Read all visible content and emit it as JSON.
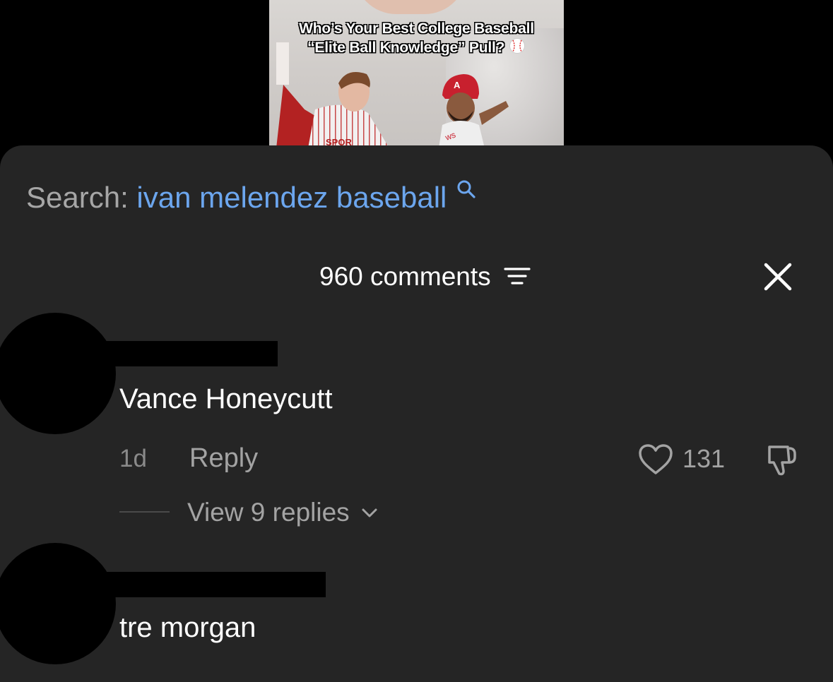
{
  "video": {
    "title_line1": "Who’s Your Best College Baseball",
    "title_line2": "“Elite Ball Knowledge” Pull?",
    "jersey_text": "SPOR"
  },
  "search": {
    "prefix": "Search:",
    "query": "ivan melendez baseball"
  },
  "header": {
    "comment_count_label": "960 comments"
  },
  "comments": [
    {
      "text": "Vance Honeycutt",
      "time": "1d",
      "reply_label": "Reply",
      "like_count": "131",
      "view_replies_label": "View 9 replies"
    },
    {
      "text": "tre morgan"
    }
  ],
  "colors": {
    "panel_bg": "#252525",
    "search_query": "#6ca6ee",
    "muted_text": "#a3a3a3"
  },
  "icons": [
    "search-icon",
    "sort-icon",
    "close-icon",
    "heart-icon",
    "dislike-icon",
    "chevron-down-icon",
    "baseball-icon"
  ]
}
